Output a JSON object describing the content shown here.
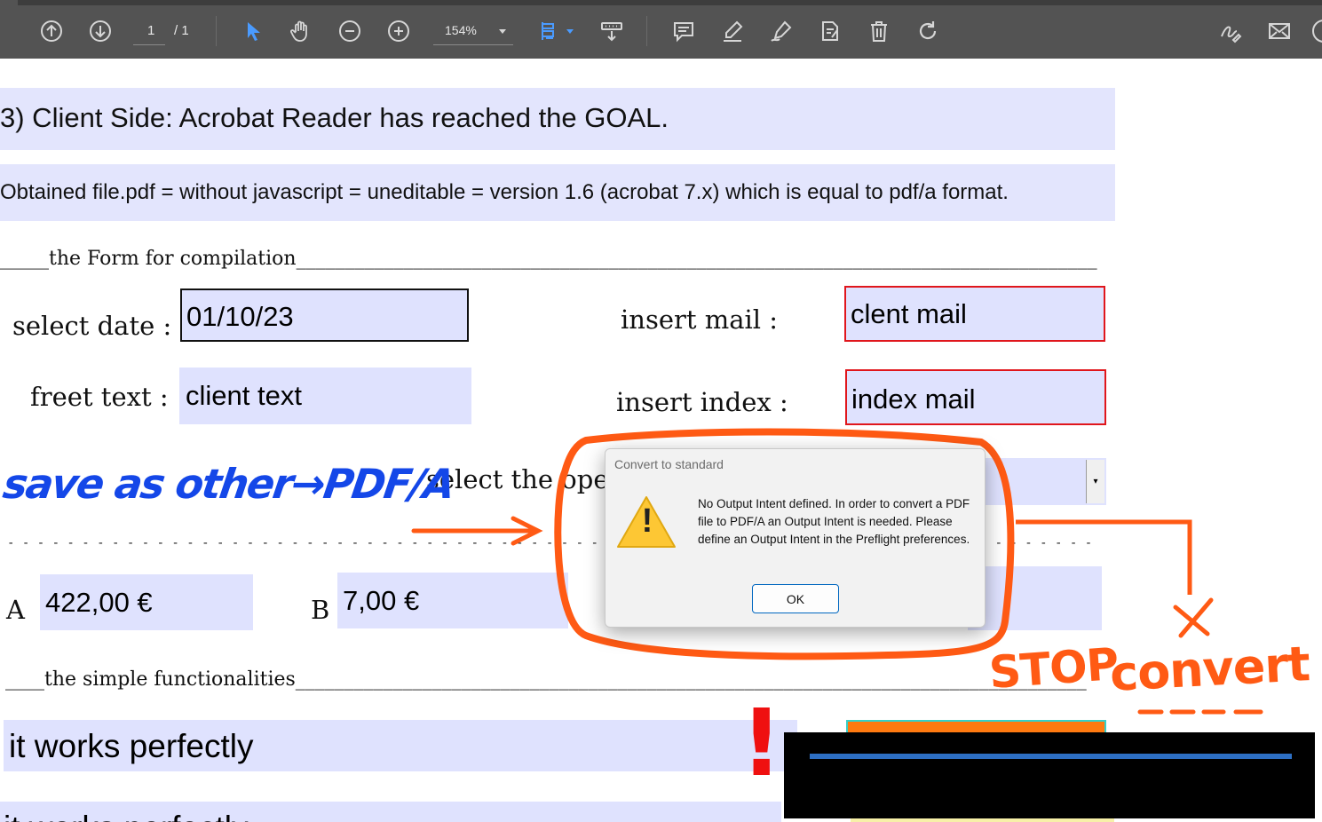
{
  "toolbar": {
    "page_current": "1",
    "page_total": "/ 1",
    "zoom": "154%",
    "icons": [
      "arrow-up-circle-icon",
      "arrow-down-circle-icon",
      "select-cursor-icon",
      "hand-icon",
      "zoom-out-icon",
      "zoom-in-icon",
      "fit-page-icon",
      "scroll-mode-icon",
      "comment-icon",
      "highlight-icon",
      "draw-icon",
      "edit-icon",
      "delete-icon",
      "rotate-icon",
      "sign-icon",
      "mail-icon"
    ]
  },
  "document": {
    "heading": "3) Client Side: Acrobat Reader has reached the GOAL.",
    "subheading": "Obtained file.pdf = without javascript = uneditable = version 1.6 (acrobat 7.x) which is equal to pdf/a format.",
    "form_section_line": "_____the Form for compilation__________________________________________________________________________________",
    "labels": {
      "select_date": "select date :",
      "freet_text": "freet text :",
      "insert_mail": "insert mail :",
      "insert_index": "insert index :",
      "select_the_oper": "select the oper",
      "a": "A",
      "b": "B"
    },
    "fields": {
      "date": "01/10/23",
      "client_text": "client text",
      "mail": "clent mail",
      "index": "index mail",
      "amount_a": "422,00 €",
      "amount_b": "7,00 €",
      "works": "it works perfectly",
      "partial_bottom": "it works perfectly"
    },
    "dashed_line": "- - - - - - - - - - - - - - - - - - - - - - - - - - - - - - - - - - - - - - - - - - - - - - - - - - - - - - - - - - - - - - - - - - - - - - - - - - - - - - - - - - - - - -",
    "simple_section_line": "____the simple functionalities_________________________________________________________________________________"
  },
  "annotations": {
    "save_as": "save as other→PDF/A",
    "stop": "STOP",
    "convert": "convert",
    "exclamation": "!"
  },
  "dialog": {
    "title": "Convert to standard",
    "message": "No Output Intent defined. In order to convert a PDF file to PDF/A an Output Intent is needed. Please define an Output Intent in the Preflight preferences.",
    "ok": "OK",
    "warning_mark": "!"
  },
  "colors": {
    "toolbar": "#535353",
    "field_fill": "#dfe2fe",
    "red_border": "#e0161c",
    "annotation_blue": "#1447e8",
    "annotation_orange": "#ff5a14",
    "dialog_bg": "#f2f2f2",
    "ok_border": "#0067c0"
  }
}
